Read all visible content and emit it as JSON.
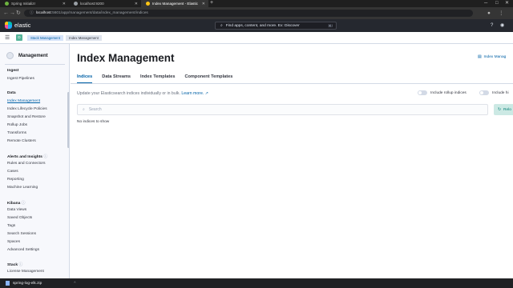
{
  "browser": {
    "tabs": [
      {
        "title": "Spring Initializr",
        "active": false
      },
      {
        "title": "localhost:9200",
        "active": false
      },
      {
        "title": "Index Management - Elastic",
        "active": true
      }
    ],
    "url_host": "localhost",
    "url_path": ":5601/app/management/data/index_management/indices",
    "download": {
      "filename": "spring-log-elk.zip"
    }
  },
  "kibana": {
    "logo_text": "elastic",
    "global_search_placeholder": "Find apps, content, and more. Ex: Discover",
    "global_search_shortcut": "⌘/",
    "space_initial": "D",
    "breadcrumbs": [
      "Stack Management",
      "Index Management"
    ]
  },
  "sidebar": {
    "title": "Management",
    "groups": [
      {
        "label": "Ingest",
        "items": [
          "Ingest Pipelines"
        ]
      },
      {
        "label": "Data",
        "items": [
          "Index Management",
          "Index Lifecycle Policies",
          "Snapshot and Restore",
          "Rollup Jobs",
          "Transforms",
          "Remote Clusters"
        ]
      },
      {
        "label": "Alerts and Insights",
        "items": [
          "Rules and Connectors",
          "Cases",
          "Reporting",
          "Machine Learning"
        ]
      },
      {
        "label": "Kibana",
        "items": [
          "Data Views",
          "Saved Objects",
          "Tags",
          "Search Sessions",
          "Spaces",
          "Advanced Settings"
        ]
      },
      {
        "label": "Stack",
        "items": [
          "License Management"
        ]
      }
    ],
    "active_item": "Index Management"
  },
  "main": {
    "title": "Index Management",
    "docs_link": "Index Manag",
    "tabs": [
      "Indices",
      "Data Streams",
      "Index Templates",
      "Component Templates"
    ],
    "active_tab": "Indices",
    "description": "Update your Elasticsearch indices individually or in bulk.",
    "learn_more": "Learn more.",
    "toggle_rollup": "Include rollup indices",
    "toggle_hidden": "Include hi",
    "search_placeholder": "Search",
    "reload_label": "Relo",
    "empty_message": "No indices to show"
  },
  "colors": {
    "accent": "#0061a6",
    "header_bg": "#25282f",
    "space_badge": "#54b399",
    "reload_bg": "#cce9e4"
  }
}
